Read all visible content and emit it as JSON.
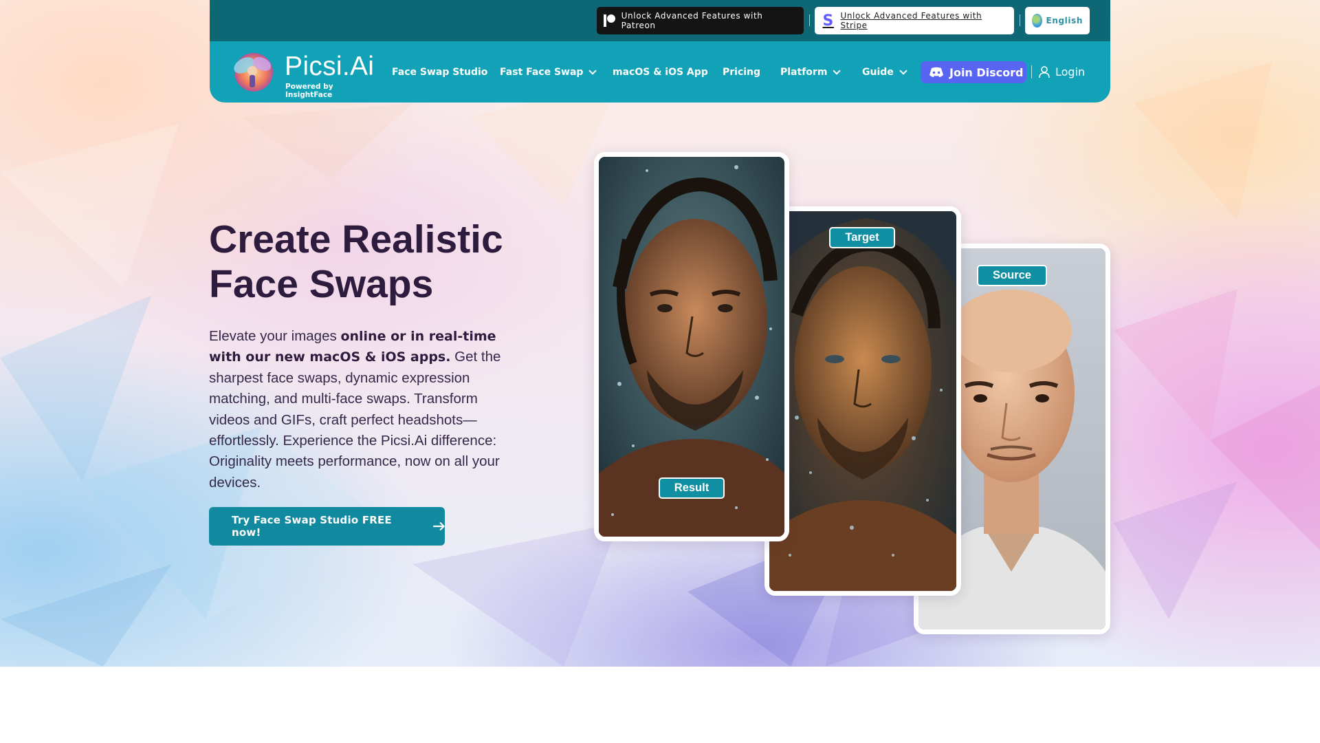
{
  "topbar": {
    "patreon_label": "Unlock Advanced Features with Patreon",
    "stripe_label": "Unlock Advanced Features with Stripe",
    "language_label": "English"
  },
  "brand": {
    "name": "Picsi.Ai",
    "tagline": "Powered by InsightFace"
  },
  "nav": {
    "items": [
      {
        "label": "Face Swap Studio",
        "dropdown": false
      },
      {
        "label": "Fast Face Swap",
        "dropdown": true
      },
      {
        "label": "macOS & iOS App",
        "dropdown": false
      },
      {
        "label": "Pricing",
        "dropdown": false
      },
      {
        "label": "Platform",
        "dropdown": true
      },
      {
        "label": "Guide",
        "dropdown": true
      }
    ],
    "discord_label": "Join Discord",
    "login_label": "Login"
  },
  "hero": {
    "title_line1": "Create Realistic",
    "title_line2": "Face Swaps",
    "desc_part1": "Elevate your images ",
    "desc_bold": "online or in real-time with our new macOS & iOS apps.",
    "desc_part2": " Get the sharpest face swaps, dynamic expression matching, and multi-face swaps. Transform videos and GIFs, craft perfect headshots—effortlessly. Experience the Picsi.Ai difference: Originality meets performance, now on all your devices.",
    "cta_label": "Try Face Swap Studio FREE now!"
  },
  "images": {
    "result_label": "Result",
    "target_label": "Target",
    "source_label": "Source"
  },
  "colors": {
    "topbar": "#0e6775",
    "header": "#11a2b8",
    "discord": "#5865f2",
    "cta": "#118aa0",
    "title": "#2d1c3e"
  },
  "icons": {
    "patreon": "patreon-icon",
    "stripe": "stripe-icon",
    "language": "globe-icon",
    "dropdown": "chevron-down-icon",
    "discord": "discord-icon",
    "login": "user-icon",
    "cta": "arrow-right-icon"
  }
}
